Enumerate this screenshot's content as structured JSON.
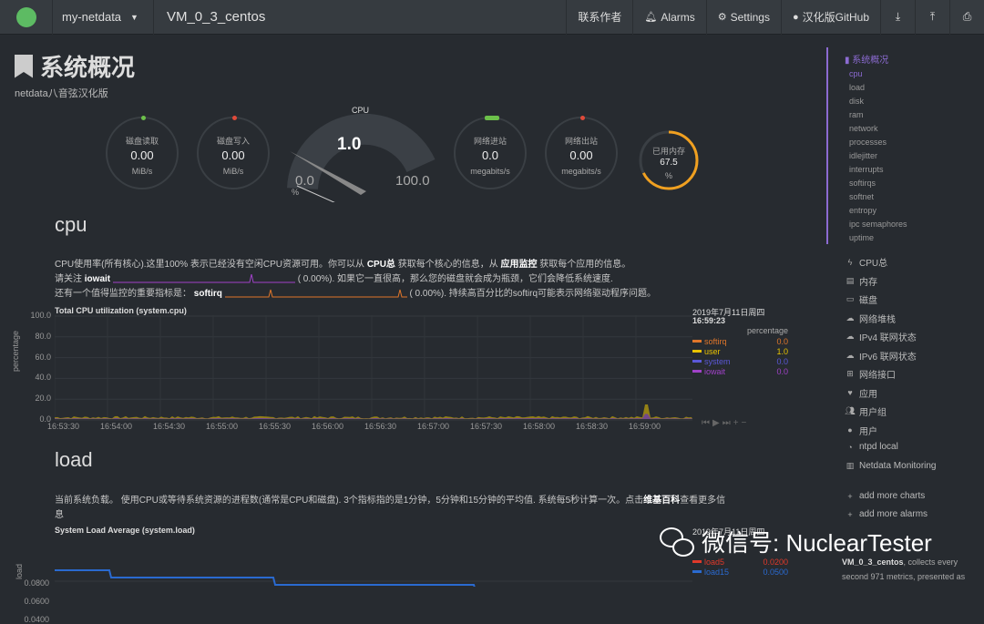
{
  "topbar": {
    "host_menu": "my-netdata",
    "title": "VM_0_3_centos",
    "buttons": [
      {
        "label": "联系作者",
        "icon": ""
      },
      {
        "label": "Alarms",
        "icon": "bell-icon"
      },
      {
        "label": "Settings",
        "icon": "gear-icon"
      },
      {
        "label": "汉化版GitHub",
        "icon": "github-icon"
      }
    ]
  },
  "page": {
    "title": "系统概况",
    "subtitle": "netdata八音弦汉化版"
  },
  "gauges": {
    "disk_read": {
      "label": "磁盘读取",
      "value": "0.00",
      "unit": "MiB/s"
    },
    "disk_write": {
      "label": "磁盘写入",
      "value": "0.00",
      "unit": "MiB/s"
    },
    "cpu": {
      "label": "CPU",
      "value": "1.0",
      "min": "0.0",
      "max": "100.0",
      "unit": "%",
      "fraction": 0.01
    },
    "net_in": {
      "label": "网络进站",
      "value": "0.0",
      "unit": "megabits/s"
    },
    "net_out": {
      "label": "网络出站",
      "value": "0.00",
      "unit": "megabits/s"
    },
    "ram": {
      "label": "已用内存",
      "value": "67.5",
      "unit": "%",
      "fraction": 0.675
    }
  },
  "cpu_section": {
    "heading": "cpu",
    "line1_a": "CPU使用率(所有核心).这里100% 表示已经没有空闲CPU资源可用。你可以从",
    "line1_link1": "CPU总",
    "line1_b": "获取每个核心的信息，从",
    "line1_link2": "应用监控",
    "line1_c": "获取每个应用的信息。",
    "line2_a": "请关注",
    "line2_key": "iowait",
    "line2_val": "(      0.00%). 如果它一直很高，那么您的磁盘就会成为瓶颈，它们会降低系统速度.",
    "line3_a": "还有一个值得监控的重要指标是：",
    "line3_key": "softirq",
    "line3_val": "(      0.00%). 持续高百分比的softirq可能表示网络驱动程序问题。"
  },
  "cpu_chart": {
    "title": "Total CPU utilization (system.cpu)",
    "ylabel": "percentage",
    "date": "2019年7月11日周四",
    "time": "16:59:23",
    "legend_header": "percentage",
    "yticks": [
      "100.0",
      "80.0",
      "60.0",
      "40.0",
      "20.0",
      "0.0"
    ],
    "xticks": [
      "16:53:30",
      "16:54:00",
      "16:54:30",
      "16:55:00",
      "16:55:30",
      "16:56:00",
      "16:56:30",
      "16:57:00",
      "16:57:30",
      "16:58:00",
      "16:58:30",
      "16:59:00"
    ],
    "series": [
      {
        "name": "softirq",
        "value": "0.0",
        "color": "#e0762a"
      },
      {
        "name": "user",
        "value": "1.0",
        "color": "#e8c200"
      },
      {
        "name": "system",
        "value": "0.0",
        "color": "#5b58d8"
      },
      {
        "name": "iowait",
        "value": "0.0",
        "color": "#a042c8"
      }
    ]
  },
  "load_section": {
    "heading": "load",
    "desc_a": "当前系统负载。 使用CPU或等待系统资源的进程数(通常是CPU和磁盘). 3个指标指的是1分钟，5分钟和15分钟的平均值. 系统每5秒计算一次。点击",
    "desc_link": "维基百科",
    "desc_b": "查看更多信",
    "desc_line2": "息"
  },
  "load_chart": {
    "title": "System Load Average (system.load)",
    "ylabel": "load",
    "date_partial": "2019年7月11日周四",
    "yticks": [
      "0.0800",
      "0.0600",
      "0.0400"
    ],
    "series": [
      {
        "name": "load5",
        "value": "0.0200",
        "color": "#e0392a"
      },
      {
        "name": "load15",
        "value": "0.0500",
        "color": "#2a6ad0"
      }
    ]
  },
  "sidebar": {
    "active": "系统概况",
    "subitems": [
      "cpu",
      "load",
      "disk",
      "ram",
      "network",
      "processes",
      "idlejitter",
      "interrupts",
      "softirqs",
      "softnet",
      "entropy",
      "ipc semaphores",
      "uptime"
    ],
    "items": [
      {
        "label": "CPU总",
        "icon": "bolt-icon"
      },
      {
        "label": "内存",
        "icon": "database-icon"
      },
      {
        "label": "磁盘",
        "icon": "hdd-icon"
      },
      {
        "label": "网络堆栈",
        "icon": "cloud-icon"
      },
      {
        "label": "IPv4 联网状态",
        "icon": "cloud-icon"
      },
      {
        "label": "IPv6 联网状态",
        "icon": "cloud-icon"
      },
      {
        "label": "网络接口",
        "icon": "sitemap-icon"
      },
      {
        "label": "应用",
        "icon": "heart-icon"
      },
      {
        "label": "用户组",
        "icon": "users-icon"
      },
      {
        "label": "用户",
        "icon": "user-icon"
      },
      {
        "label": "ntpd local",
        "icon": "clock-icon"
      },
      {
        "label": "Netdata Monitoring",
        "icon": "chart-icon"
      }
    ],
    "add_charts": "add more charts",
    "add_alarms": "add more alarms"
  },
  "footer": {
    "host": "VM_0_3_centos",
    "text_a": ", collects every",
    "text_b": "second 971 metrics, presented as"
  },
  "watermark": {
    "text": "微信号: NuclearTester"
  },
  "colors": {
    "accent": "#8c6bd2",
    "background": "#272b30",
    "topbar": "#363b40",
    "logo": "#5dbb63"
  }
}
